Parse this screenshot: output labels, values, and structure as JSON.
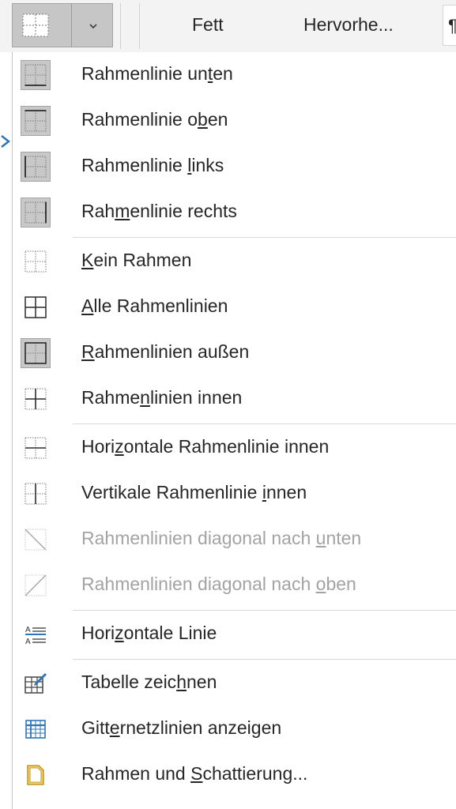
{
  "ribbon": {
    "borders_button": {
      "icon": "no-border-icon",
      "dropdown_icon": "chevron-down-icon"
    },
    "styles": [
      "Fett",
      "Hervorhe..."
    ],
    "pilcrow": "¶"
  },
  "menu": {
    "items": [
      {
        "pre": "Rahmenlinie un",
        "acc": "t",
        "post": "en",
        "icon": "bottom-border-icon",
        "selected": true,
        "disabled": false
      },
      {
        "pre": "Rahmenlinie o",
        "acc": "b",
        "post": "en",
        "icon": "top-border-icon",
        "selected": true,
        "disabled": false
      },
      {
        "pre": "Rahmenlinie ",
        "acc": "l",
        "post": "inks",
        "icon": "left-border-icon",
        "selected": true,
        "disabled": false
      },
      {
        "pre": "Rah",
        "acc": "m",
        "post": "enlinie rechts",
        "icon": "right-border-icon",
        "selected": true,
        "disabled": false
      },
      {
        "pre": "",
        "acc": "K",
        "post": "ein Rahmen",
        "icon": "no-border-icon",
        "selected": false,
        "disabled": false
      },
      {
        "pre": "",
        "acc": "A",
        "post": "lle Rahmenlinien",
        "icon": "all-borders-icon",
        "selected": false,
        "disabled": false
      },
      {
        "pre": "",
        "acc": "R",
        "post": "ahmenlinien außen",
        "icon": "outside-borders-icon",
        "selected": true,
        "disabled": false
      },
      {
        "pre": "Rahme",
        "acc": "n",
        "post": "linien innen",
        "icon": "inside-borders-icon",
        "selected": false,
        "disabled": false
      },
      {
        "pre": "Hori",
        "acc": "z",
        "post": "ontale Rahmenlinie innen",
        "icon": "inside-horizontal-border-icon",
        "selected": false,
        "disabled": false
      },
      {
        "pre": "Vertikale Rahmenlinie ",
        "acc": "i",
        "post": "nnen",
        "icon": "inside-vertical-border-icon",
        "selected": false,
        "disabled": false
      },
      {
        "pre": "Rahmenlinien diagonal nach ",
        "acc": "u",
        "post": "nten",
        "icon": "diagonal-down-border-icon",
        "selected": false,
        "disabled": true
      },
      {
        "pre": "Rahmenlinien diagonal nach ",
        "acc": "o",
        "post": "ben",
        "icon": "diagonal-up-border-icon",
        "selected": false,
        "disabled": true
      },
      {
        "pre": "Hori",
        "acc": "z",
        "post": "ontale Linie",
        "icon": "horizontal-line-icon",
        "selected": false,
        "disabled": false
      },
      {
        "pre": "Tabelle zeic",
        "acc": "h",
        "post": "nen",
        "icon": "draw-table-icon",
        "selected": false,
        "disabled": false
      },
      {
        "pre": "Gitt",
        "acc": "e",
        "post": "rnetzlinien anzeigen",
        "icon": "view-gridlines-icon",
        "selected": false,
        "disabled": false
      },
      {
        "pre": "Rahmen und ",
        "acc": "S",
        "post": "chattierung...",
        "icon": "borders-and-shading-icon",
        "selected": false,
        "disabled": false
      }
    ],
    "icon_text": {
      "horizontal_line": [
        "A",
        "A"
      ]
    }
  },
  "colors": {
    "accent_blue": "#2e75b6",
    "selected_bg": "#c8c8c8",
    "disabled_text": "#a3a3a3",
    "text": "#262626",
    "ribbon_bg": "#f3f3f3"
  }
}
